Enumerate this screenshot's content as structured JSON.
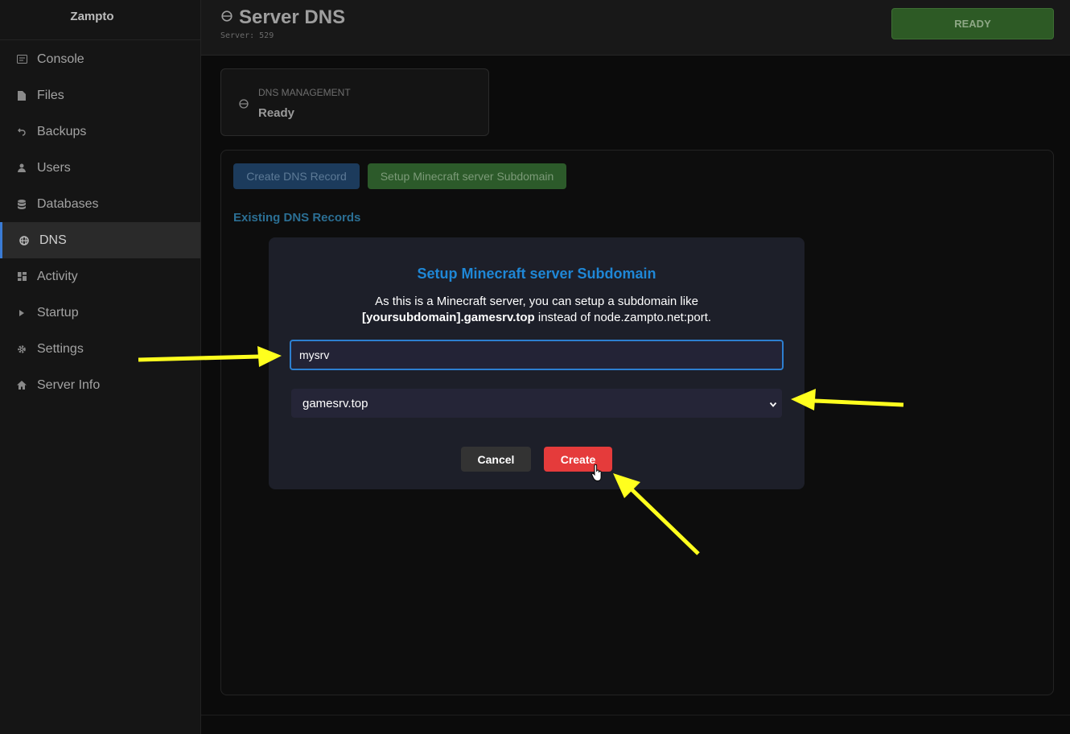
{
  "app": {
    "name": "Zampto"
  },
  "sidebar": {
    "items": [
      {
        "label": "Console",
        "icon": "console-icon"
      },
      {
        "label": "Files",
        "icon": "file-icon"
      },
      {
        "label": "Backups",
        "icon": "backup-icon"
      },
      {
        "label": "Users",
        "icon": "user-icon"
      },
      {
        "label": "Databases",
        "icon": "database-icon"
      },
      {
        "label": "DNS",
        "icon": "globe-icon",
        "active": true
      },
      {
        "label": "Activity",
        "icon": "grid-icon"
      },
      {
        "label": "Startup",
        "icon": "play-icon"
      },
      {
        "label": "Settings",
        "icon": "gear-icon"
      },
      {
        "label": "Server Info",
        "icon": "home-icon"
      }
    ]
  },
  "header": {
    "title": "Server DNS",
    "server_id": "Server: 529",
    "status_button": "READY"
  },
  "status_card": {
    "label": "DNS MANAGEMENT",
    "value": "Ready"
  },
  "panel": {
    "create_dns_button": "Create DNS Record",
    "setup_mc_button": "Setup Minecraft server Subdomain",
    "existing_title": "Existing DNS Records"
  },
  "modal": {
    "title": "Setup Minecraft server Subdomain",
    "desc_line1": "As this is a Minecraft server, you can setup a subdomain like",
    "desc_bold": "[yoursubdomain].gamesrv.top",
    "desc_rest": " instead of node.zampto.net:port.",
    "subdomain_value": "mysrv",
    "domain_selected": "gamesrv.top",
    "cancel_label": "Cancel",
    "create_label": "Create"
  },
  "colors": {
    "accent_blue": "#1f87d6",
    "create_red": "#e53b3b",
    "ready_green": "#2d5a25",
    "annotation_arrow": "#ffff1e"
  }
}
